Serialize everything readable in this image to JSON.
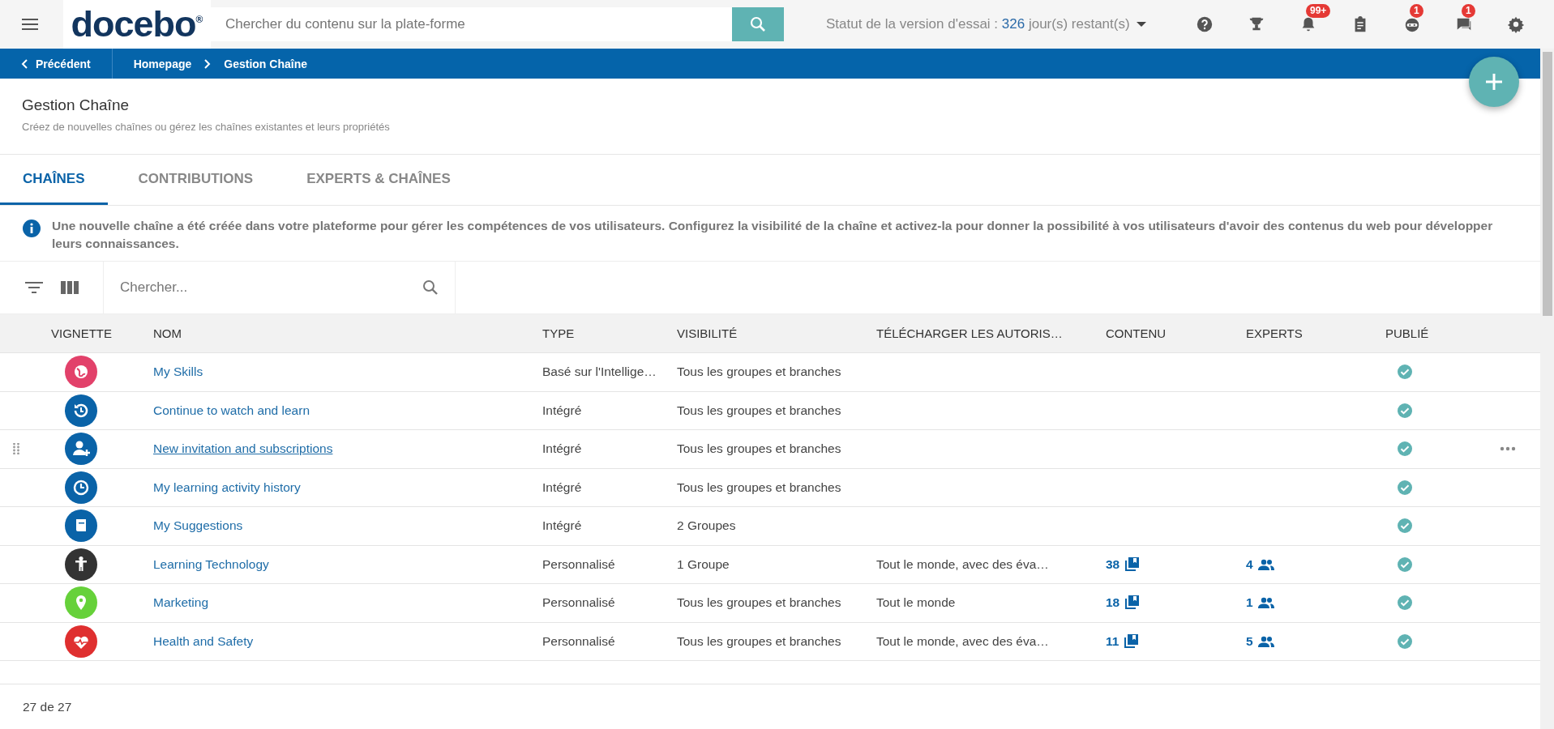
{
  "topbar": {
    "logo": "docebo",
    "logo_mark": "®",
    "search_placeholder": "Chercher du contenu sur la plate-forme",
    "trial_label": "Statut de la version d'essai :",
    "trial_days": "326",
    "trial_suffix": "jour(s) restant(s)",
    "icons": [
      {
        "kind": "help"
      },
      {
        "kind": "trophy"
      },
      {
        "kind": "bell",
        "badge": "99+"
      },
      {
        "kind": "clipboard"
      },
      {
        "kind": "robot",
        "badge": "1"
      },
      {
        "kind": "chat",
        "badge": "1"
      },
      {
        "kind": "gear"
      }
    ]
  },
  "breadcrumb": {
    "back": "Précédent",
    "items": [
      "Homepage",
      "Gestion Chaîne"
    ]
  },
  "page": {
    "title": "Gestion Chaîne",
    "subtitle": "Créez de nouvelles chaînes ou gérez les chaînes existantes et leurs propriétés"
  },
  "tabs": [
    {
      "label": "CHAÎNES",
      "selected": true
    },
    {
      "label": "CONTRIBUTIONS",
      "selected": false
    },
    {
      "label": "EXPERTS & CHAÎNES",
      "selected": false
    }
  ],
  "info": "Une nouvelle chaîne a été créée dans votre plateforme pour gérer les compétences de vos utilisateurs. Configurez la visibilité de la chaîne et activez-la pour donner la possibilité à vos utilisateurs d'avoir des contenus du web pour développer leurs connaissances.",
  "toolbar": {
    "search_placeholder": "Chercher..."
  },
  "table": {
    "columns": [
      "VIGNETTE",
      "NOM",
      "TYPE",
      "VISIBILITÉ",
      "TÉLÉCHARGER LES AUTORIS…",
      "CONTENU",
      "EXPERTS",
      "PUBLIÉ"
    ],
    "rows": [
      {
        "kind": "globe",
        "color": "#e2416a",
        "name": "My Skills",
        "type": "Basé sur l'Intellige…",
        "visibility": "Tous les groupes et branches",
        "permissions": null,
        "content": null,
        "experts": null,
        "published": true,
        "hovered": false
      },
      {
        "kind": "history",
        "color": "#0a63a8",
        "name": "Continue to watch and learn",
        "type": "Intégré",
        "visibility": "Tous les groupes et branches",
        "permissions": null,
        "content": null,
        "experts": null,
        "published": true,
        "hovered": false
      },
      {
        "kind": "user-plus",
        "color": "#0a63a8",
        "name": "New invitation and subscriptions",
        "type": "Intégré",
        "visibility": "Tous les groupes et branches",
        "permissions": null,
        "content": null,
        "experts": null,
        "published": true,
        "hovered": true
      },
      {
        "kind": "clock",
        "color": "#0a63a8",
        "name": "My learning activity history",
        "type": "Intégré",
        "visibility": "Tous les groupes et branches",
        "permissions": null,
        "content": null,
        "experts": null,
        "published": true,
        "hovered": false
      },
      {
        "kind": "book",
        "color": "#0a63a8",
        "name": "My Suggestions",
        "type": "Intégré",
        "visibility": "2 Groupes",
        "permissions": null,
        "content": null,
        "experts": null,
        "published": true,
        "hovered": false
      },
      {
        "kind": "person",
        "color": "#333333",
        "name": "Learning Technology",
        "type": "Personnalisé",
        "visibility": "1 Groupe",
        "permissions": "Tout le monde, avec des éva…",
        "content": "38",
        "experts": "4",
        "published": true,
        "hovered": false
      },
      {
        "kind": "pin",
        "color": "#66d13a",
        "name": "Marketing",
        "type": "Personnalisé",
        "visibility": "Tous les groupes et branches",
        "permissions": "Tout le monde",
        "content": "18",
        "experts": "1",
        "published": true,
        "hovered": false
      },
      {
        "kind": "heart",
        "color": "#df2f2f",
        "name": "Health and Safety",
        "type": "Personnalisé",
        "visibility": "Tous les groupes et branches",
        "permissions": "Tout le monde, avec des éva…",
        "content": "11",
        "experts": "5",
        "published": true,
        "hovered": false
      }
    ]
  },
  "footer": {
    "count": "27 de 27"
  }
}
